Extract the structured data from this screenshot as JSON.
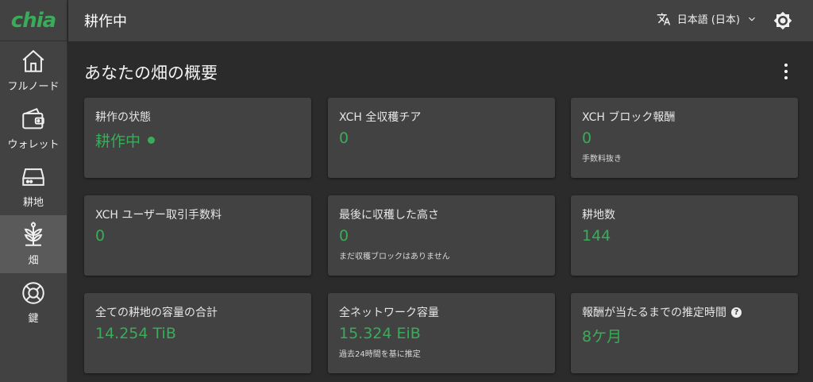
{
  "app": {
    "logo": "chia"
  },
  "sidebar": {
    "items": [
      {
        "label": "フルノード",
        "icon": "home-icon",
        "active": false
      },
      {
        "label": "ウォレット",
        "icon": "wallet-icon",
        "active": false
      },
      {
        "label": "耕地",
        "icon": "hard-drive-icon",
        "active": false
      },
      {
        "label": "畑",
        "icon": "plant-icon",
        "active": true
      },
      {
        "label": "鍵",
        "icon": "lifebuoy-icon",
        "active": false
      }
    ]
  },
  "header": {
    "title": "耕作中",
    "language": "日本語 (日本)"
  },
  "main": {
    "title": "あなたの畑の概要",
    "cards": [
      {
        "label": "耕作の状態",
        "value": "耕作中",
        "note": ""
      },
      {
        "label": "XCH 全収穫チア",
        "value": "0",
        "note": ""
      },
      {
        "label": "XCH ブロック報酬",
        "value": "0",
        "note": "手数料抜き"
      },
      {
        "label": "XCH ユーザー取引手数料",
        "value": "0",
        "note": ""
      },
      {
        "label": "最後に収穫した高さ",
        "value": "0",
        "note": "まだ収穫ブロックはありません"
      },
      {
        "label": "耕地数",
        "value": "144",
        "note": ""
      },
      {
        "label": "全ての耕地の容量の合計",
        "value": "14.254 TiB",
        "note": ""
      },
      {
        "label": "全ネットワーク容量",
        "value": "15.324 EiB",
        "note": "過去24時間を基に推定"
      },
      {
        "label": "報酬が当たるまでの推定時間",
        "value": "8ケ月",
        "note": ""
      }
    ]
  },
  "colors": {
    "accent": "#3aac59",
    "surface": "#424242",
    "background": "#2b2b2b"
  }
}
